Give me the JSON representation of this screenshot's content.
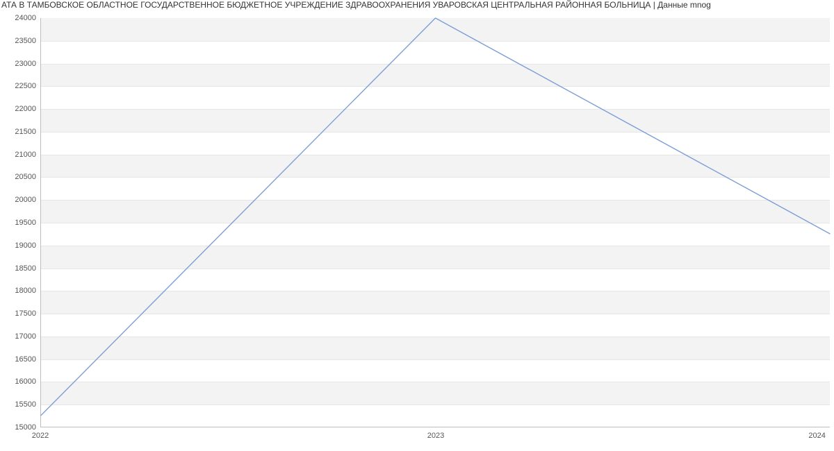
{
  "chart_data": {
    "type": "line",
    "title": "АТА В ТАМБОВСКОЕ ОБЛАСТНОЕ ГОСУДАРСТВЕННОЕ БЮДЖЕТНОЕ УЧРЕЖДЕНИЕ ЗДРАВООХРАНЕНИЯ УВАРОВСКАЯ ЦЕНТРАЛЬНАЯ РАЙОННАЯ БОЛЬНИЦА | Данные mnog",
    "categories": [
      "2022",
      "2023",
      "2024"
    ],
    "values": [
      15250,
      24000,
      19250
    ],
    "xlabel": "",
    "ylabel": "",
    "ylim": [
      15000,
      24000
    ],
    "yticks": [
      15000,
      15500,
      16000,
      16500,
      17000,
      17500,
      18000,
      18500,
      19000,
      19500,
      20000,
      20500,
      21000,
      21500,
      22000,
      22500,
      23000,
      23500,
      24000
    ],
    "line_color": "#7c9fd6"
  }
}
